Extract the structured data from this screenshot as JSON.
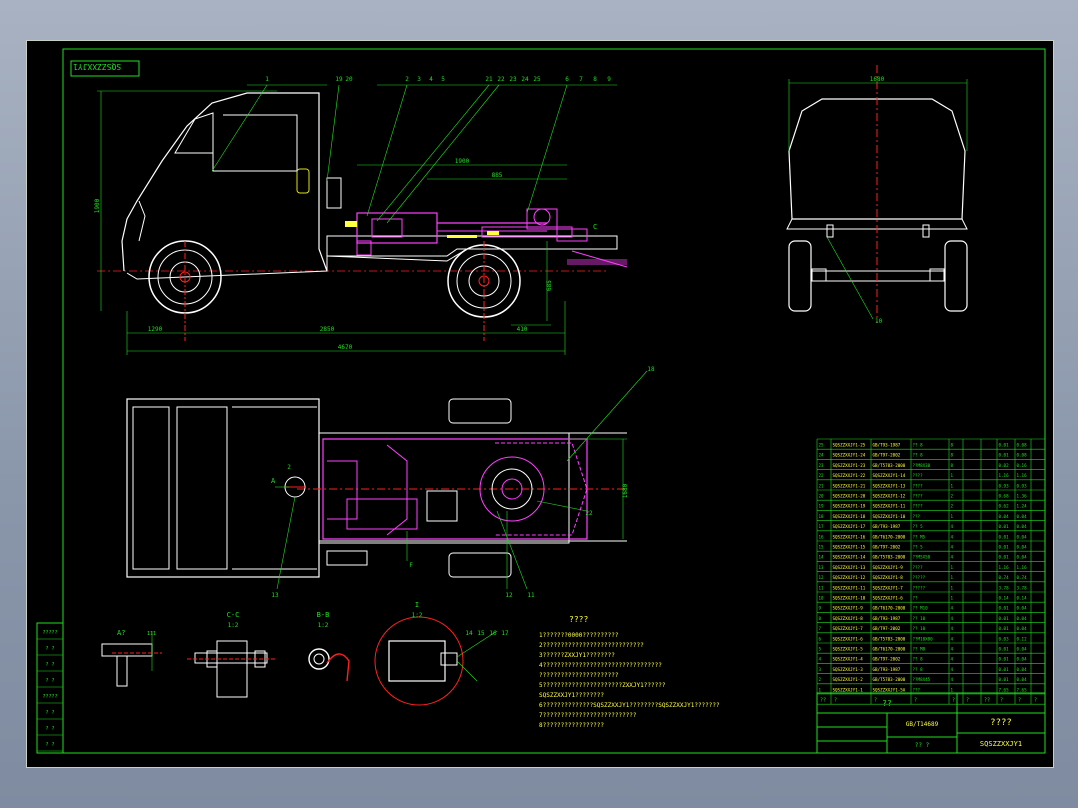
{
  "drawing_code_tl": "SQSZZXXJY1",
  "colors": {
    "frame": "#20e020",
    "body": "#ffffff",
    "chassis": "#ff40ff",
    "center": "#ff2020",
    "accent": "#ffff40",
    "dim": "#20e0e0"
  },
  "side_view": {
    "callouts": [
      "1",
      "19",
      "20",
      "2",
      "3",
      "4",
      "5",
      "21",
      "22",
      "23",
      "24",
      "25",
      "6",
      "7",
      "8",
      "9"
    ],
    "dim_bottom_a": "1290",
    "dim_bottom_b": "2850",
    "dim_bottom_c": "410",
    "dim_overall": "4670",
    "dim_height": "1900",
    "dim_rear": "685",
    "dim_rear2": "460",
    "dim_top1": "1900",
    "dim_top2": "885",
    "label_c": "C"
  },
  "rear_view": {
    "dim_width": "1680",
    "callout": "10"
  },
  "top_view": {
    "callouts": [
      "18",
      "2",
      "13",
      "12",
      "11",
      "22",
      "F"
    ],
    "label_a": "A",
    "dim_right": "1680"
  },
  "details": {
    "a_label": "A?",
    "a_dim": "111",
    "c_label": "C-C",
    "c_scale": "1:2",
    "b_label": "B-B",
    "b_scale": "1:2",
    "i_label": "I",
    "i_scale": "1:2",
    "i_callouts": [
      "14",
      "15",
      "16",
      "17"
    ]
  },
  "notes": {
    "title": "????",
    "lines": [
      "1???????0000??????????",
      "2????????????????????????????",
      "3??????ZXXJY1????????",
      "4?????????????????????????????????",
      "  ??????????????????????",
      "5??????????????????????ZXXJY1??????",
      "  SQSZZXXJY1????????",
      "6??????????????SQSZZXXJY1????????SQSZZXXJY1???????",
      "7??????????????????????????",
      "8?????????????????"
    ]
  },
  "left_strip": [
    "?????",
    "? ?",
    "? ?",
    "? ?",
    "?????",
    "? ?",
    "? ?",
    "? ?"
  ],
  "parts_table": {
    "rows": [
      [
        "25",
        "SQSZZXXJY1-25",
        "GB/T93-1987",
        "?? 8",
        "8",
        "0.01",
        "0.08"
      ],
      [
        "24",
        "SQSZZXXJY1-24",
        "GB/T97-2002",
        "?? 8",
        "8",
        "0.01",
        "0.08"
      ],
      [
        "23",
        "SQSZZXXJY1-23",
        "GB/T5783-2000",
        "??M8X30",
        "8",
        "0.02",
        "0.16"
      ],
      [
        "22",
        "SQSZZXXJY1-22",
        "SQSZZXXJY1-14",
        "????",
        "1",
        "1.16",
        "1.16"
      ],
      [
        "21",
        "SQSZZXXJY1-21",
        "SQSZZXXJY1-13",
        "????",
        "1",
        "0.93",
        "0.93"
      ],
      [
        "20",
        "SQSZZXXJY1-20",
        "SQSZZXXJY1-12",
        "????",
        "2",
        "0.68",
        "1.36"
      ],
      [
        "19",
        "SQSZZXXJY1-19",
        "SQSZZXXJY1-11",
        "????",
        "2",
        "0.62",
        "1.24"
      ],
      [
        "18",
        "SQSZZXXJY1-18",
        "SQSZZXXJY1-10",
        "???",
        "1",
        "0.04",
        "0.04"
      ],
      [
        "17",
        "SQSZZXXJY1-17",
        "GB/T93-1987",
        "?? 5",
        "4",
        "0.01",
        "0.04"
      ],
      [
        "16",
        "SQSZZXXJY1-16",
        "GB/T6170-2000",
        "?? M5",
        "4",
        "0.01",
        "0.04"
      ],
      [
        "15",
        "SQSZZXXJY1-15",
        "GB/T97-2002",
        "?? 5",
        "4",
        "0.01",
        "0.04"
      ],
      [
        "14",
        "SQSZZXXJY1-14",
        "GB/T5783-2000",
        "??M5X50",
        "4",
        "0.01",
        "0.04"
      ],
      [
        "13",
        "SQSZZXXJY1-13",
        "SQSZZXXJY1-9",
        "????",
        "1",
        "1.16",
        "1.16"
      ],
      [
        "12",
        "SQSZZXXJY1-12",
        "SQSZZXXJY1-8",
        "?????",
        "1",
        "0.74",
        "0.74"
      ],
      [
        "11",
        "SQSZZXXJY1-11",
        "SQSZZXXJY1-7",
        "?????",
        "1",
        "3.78",
        "3.78"
      ],
      [
        "10",
        "SQSZZXXJY1-10",
        "SQSZZXXJY1-6",
        "??",
        "1",
        "0.14",
        "0.14"
      ],
      [
        "9",
        "SQSZZXXJY1-9",
        "GB/T6170-2000",
        "?? M10",
        "4",
        "0.01",
        "0.04"
      ],
      [
        "8",
        "SQSZZXXJY1-8",
        "GB/T93-1987",
        "?? 10",
        "4",
        "0.01",
        "0.04"
      ],
      [
        "7",
        "SQSZZXXJY1-7",
        "GB/T97-2002",
        "?? 10",
        "4",
        "0.01",
        "0.04"
      ],
      [
        "6",
        "SQSZZXXJY1-6",
        "GB/T5783-2000",
        "??M10X80",
        "4",
        "0.03",
        "0.12"
      ],
      [
        "5",
        "SQSZZXXJY1-5",
        "GB/T6170-2000",
        "?? M8",
        "4",
        "0.01",
        "0.04"
      ],
      [
        "4",
        "SQSZZXXJY1-4",
        "GB/T97-2002",
        "?? 8",
        "4",
        "0.01",
        "0.04"
      ],
      [
        "3",
        "SQSZZXXJY1-3",
        "GB/T93-1987",
        "?? 8",
        "4",
        "0.01",
        "0.04"
      ],
      [
        "2",
        "SQSZZXXJY1-2",
        "GB/T5783-2000",
        "??M8X45",
        "4",
        "0.01",
        "0.04"
      ],
      [
        "1",
        "SQSZZXXJY1-1",
        "SQSZZXXJY1-5A",
        "???",
        "1",
        "7.65",
        "7.65"
      ]
    ],
    "header": [
      "??",
      "?",
      "?",
      "?",
      "?",
      "?",
      "??",
      "?",
      "?",
      "?"
    ]
  },
  "title_block": {
    "company": "??",
    "drawing_name": "????",
    "standard": "GB/T14689",
    "drawing_code": "SQSZZXXJY1",
    "sheet_info": "?? ?"
  }
}
